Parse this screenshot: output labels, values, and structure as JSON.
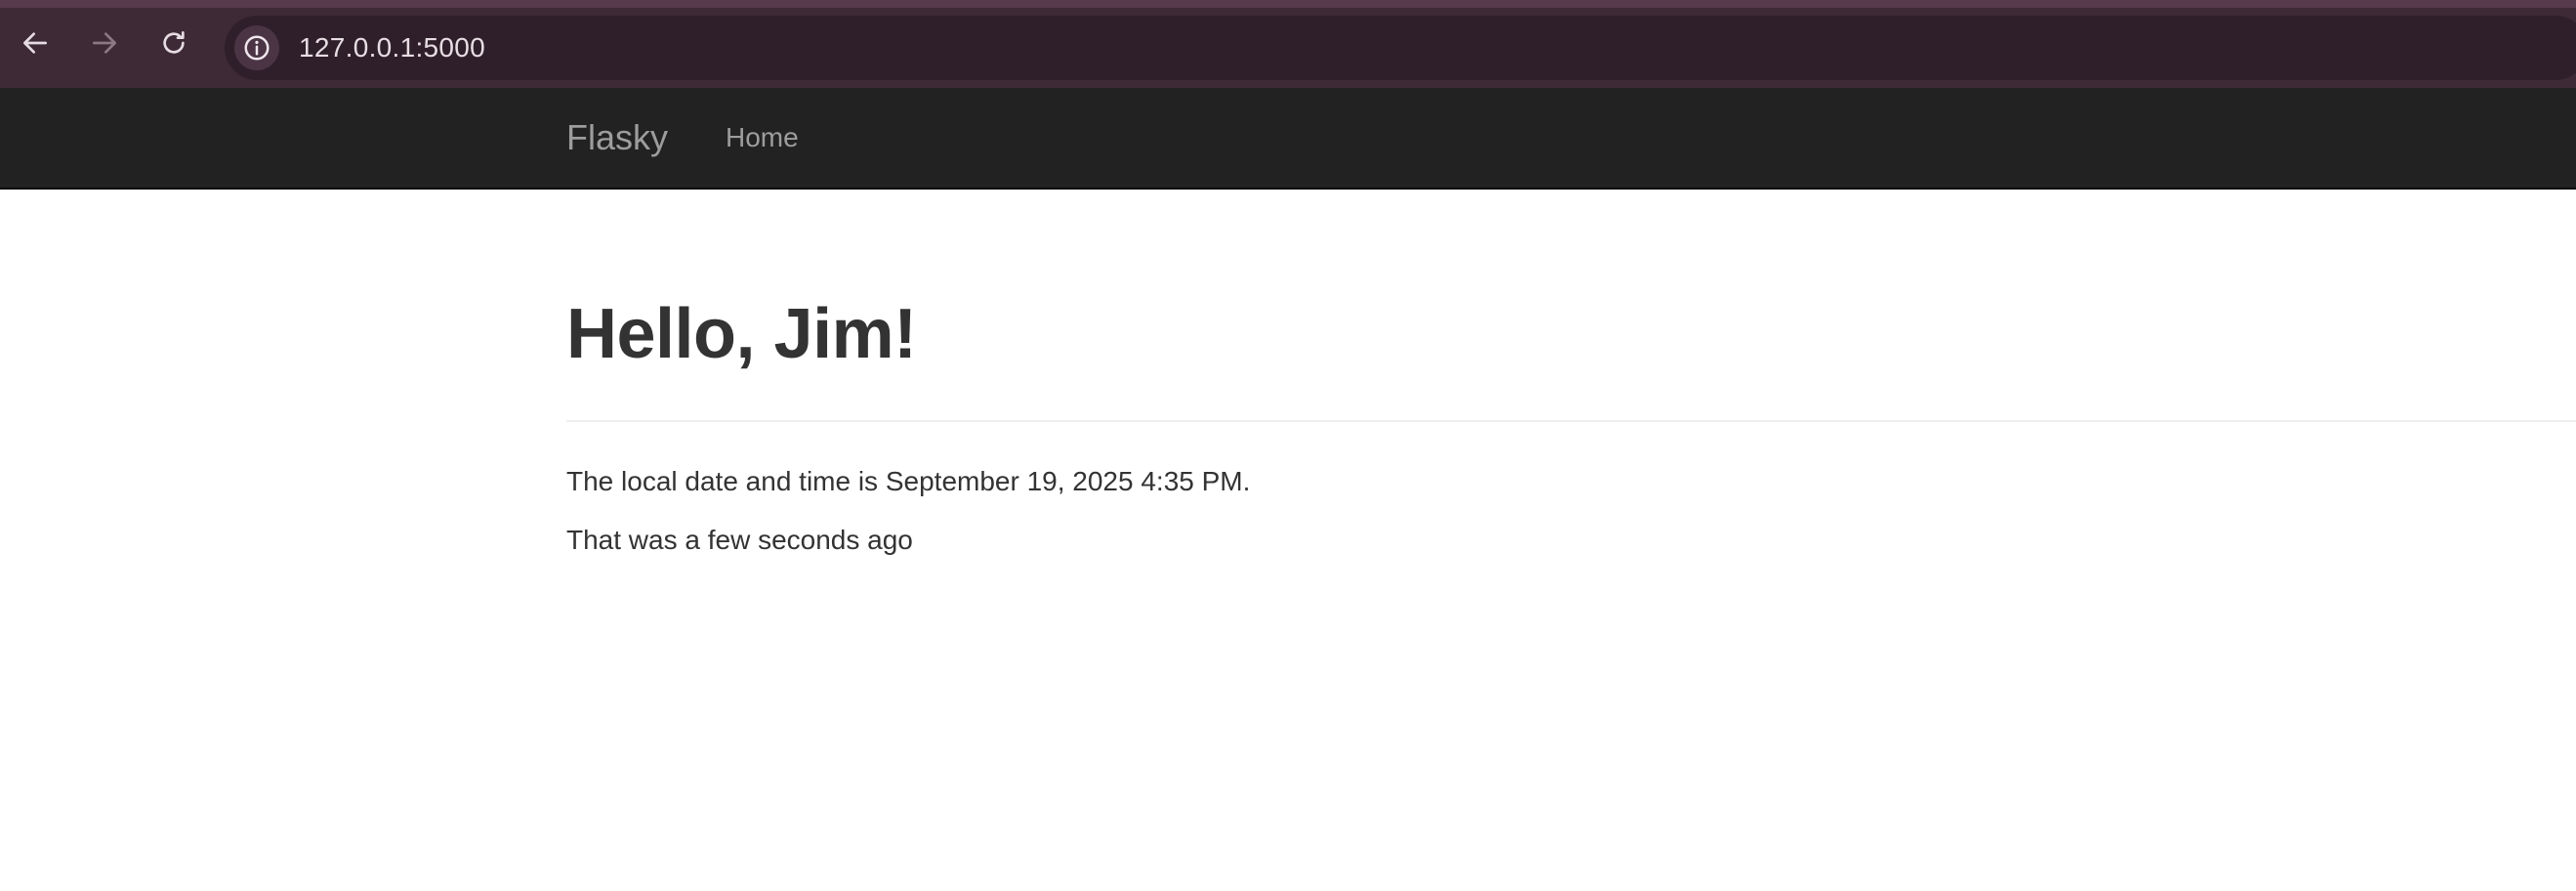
{
  "browser": {
    "url": "127.0.0.1:5000",
    "icons": {
      "back": "arrow-left-icon",
      "forward": "arrow-right-icon",
      "reload": "reload-icon",
      "site_info": "info-icon"
    },
    "colors": {
      "toolbar": "#3e2a37",
      "omnibox": "#2f1f2a"
    }
  },
  "navbar": {
    "brand": "Flasky",
    "links": [
      {
        "label": "Home"
      }
    ],
    "colors": {
      "background": "#222222",
      "text": "#9d9d9d"
    }
  },
  "main": {
    "heading": "Hello, Jim!",
    "date_text": "The local date and time is September 19, 2025 4:35 PM.",
    "ago_text": "That was a few seconds ago"
  }
}
